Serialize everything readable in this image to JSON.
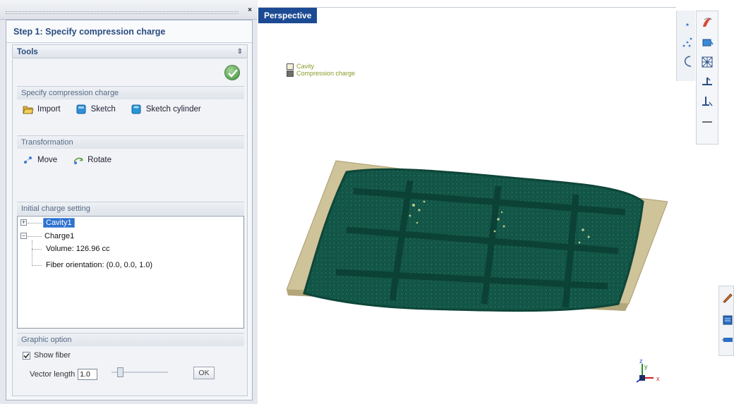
{
  "panel": {
    "step_title": "Step 1: Specify compression charge",
    "tools_label": "Tools",
    "sections": {
      "specify": {
        "title": "Specify compression charge",
        "buttons": {
          "import": "Import",
          "sketch": "Sketch",
          "sketch_cylinder": "Sketch cylinder"
        }
      },
      "transformation": {
        "title": "Transformation",
        "buttons": {
          "move": "Move",
          "rotate": "Rotate"
        }
      },
      "initial": {
        "title": "Initial charge setting",
        "tree": {
          "cavity": "Cavity1",
          "charge": "Charge1",
          "volume": "Volume: 126.96 cc",
          "fiber": "Fiber orientation: (0.0, 0.0, 1.0)"
        }
      },
      "graphic": {
        "title": "Graphic option",
        "show_fiber": "Show fiber",
        "show_fiber_checked": true,
        "vector_length_label": "Vector length",
        "vector_length_value": "1.0",
        "ok": "OK"
      }
    }
  },
  "viewport": {
    "tab": "Perspective",
    "legend": [
      "Cavity",
      "Compression charge"
    ],
    "colors": {
      "cavity": "#cfc39a",
      "charge": "#165c4e",
      "tab": "#1c4a93"
    },
    "axes": {
      "x": "x",
      "y": "y",
      "z": "z"
    }
  }
}
